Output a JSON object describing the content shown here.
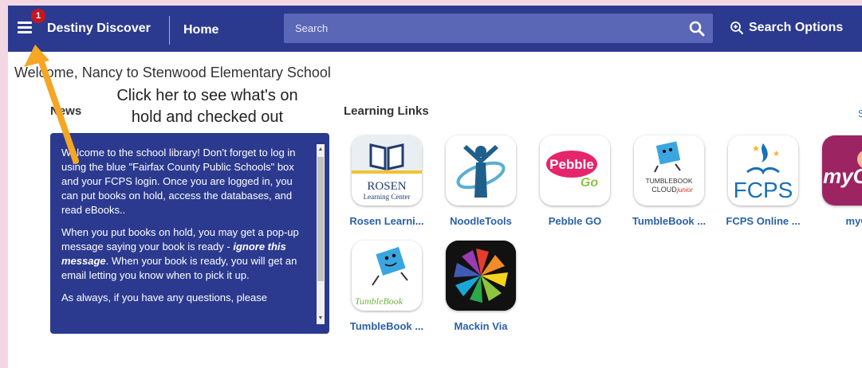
{
  "header": {
    "menu_badge": "1",
    "brand": "Destiny Discover",
    "home_label": "Home",
    "search_placeholder": "Search",
    "search_options_label": "Search Options"
  },
  "welcome": "Welcome, Nancy to Stenwood Elementary School",
  "annotation": {
    "line1": "Click her to see what's on",
    "line2": "hold and checked out"
  },
  "news": {
    "title": "News",
    "para1": "Welcome to the school library! Don't forget to log in using the blue \"Fairfax County Public Schools\" box and your FCPS login.  Once you are logged in, you can put books on hold, access the databases, and read eBooks..",
    "para2_a": "When you put books on hold, you may get a pop-up message saying your book is ready - ",
    "para2_em": "ignore this message",
    "para2_b": ".  When your book is ready, you will get an email letting you know when to pick it up.",
    "para3": "As always, if you have any questions, please"
  },
  "learning_links": {
    "title": "Learning Links",
    "see_all": "S",
    "items": [
      {
        "label": "Rosen Learni...",
        "icon": "rosen-learning-center-icon",
        "logo_text1": "ROSEN",
        "logo_text2": "Learning Center"
      },
      {
        "label": "NoodleTools",
        "icon": "noodletools-icon"
      },
      {
        "label": "Pebble GO",
        "icon": "pebble-go-icon",
        "logo_text1": "Pebble",
        "logo_text2": "Go"
      },
      {
        "label": "TumbleBook ...",
        "icon": "tumblebook-cloud-junior-icon",
        "logo_text1": "TUMBLEBOOK",
        "logo_text2": "CLOUD",
        "logo_text3": "junior"
      },
      {
        "label": "FCPS Online ...",
        "icon": "fcps-online-icon",
        "logo_text1": "FCPS"
      },
      {
        "label": "myO",
        "icon": "myon-icon",
        "logo_text1": "myO"
      },
      {
        "label": "TumbleBook ...",
        "icon": "tumblebook-library-icon",
        "logo_text1": "TumbleBook"
      },
      {
        "label": "Mackin Via",
        "icon": "mackin-via-icon"
      }
    ]
  },
  "colors": {
    "header_bg": "#2b3a8f",
    "accent_red": "#c6161d",
    "link_blue": "#2b61a8",
    "arrow_orange": "#f5a623"
  }
}
